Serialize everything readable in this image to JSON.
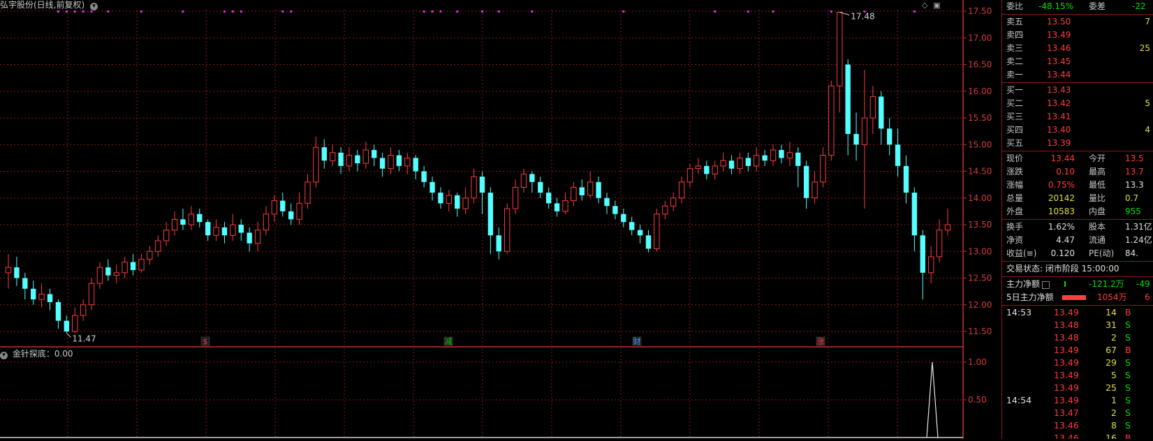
{
  "chart": {
    "title": "弘宇股份(日线,前复权)",
    "indicator_label": "金针探底：0.00",
    "y_ticks": [
      "17.50",
      "17.00",
      "16.50",
      "16.00",
      "15.50",
      "15.00",
      "14.50",
      "14.00",
      "13.50",
      "13.00",
      "12.50",
      "12.00",
      "11.50"
    ],
    "sub_y_ticks": [
      "1.00",
      "0.50"
    ],
    "high_marker": "17.48",
    "low_marker": "11.47",
    "event_marks": [
      {
        "label": "$",
        "color": "#ff3c3c"
      },
      {
        "label": "减",
        "color": "#00d000"
      },
      {
        "label": "财",
        "color": "#4aa0ff"
      },
      {
        "label": "涨",
        "color": "#ff3c3c"
      }
    ],
    "colors": {
      "up": "#ff3c3c",
      "down": "#54ffff",
      "grid": "#8b1a1a",
      "axis": "#c8302a",
      "signal": "#e030e0"
    },
    "chart_data": {
      "type": "candlestick",
      "ylim": [
        11.3,
        17.65
      ],
      "candles": [
        [
          12.6,
          12.7,
          12.95,
          12.3
        ],
        [
          12.7,
          12.5,
          12.9,
          12.35
        ],
        [
          12.5,
          12.3,
          12.6,
          12.1
        ],
        [
          12.3,
          12.1,
          12.45,
          12.0
        ],
        [
          12.1,
          12.2,
          12.4,
          11.95
        ],
        [
          12.2,
          12.05,
          12.3,
          11.9
        ],
        [
          12.05,
          11.7,
          12.1,
          11.55
        ],
        [
          11.7,
          11.5,
          11.8,
          11.47
        ],
        [
          11.5,
          11.8,
          11.95,
          11.47
        ],
        [
          11.8,
          12.0,
          12.1,
          11.7
        ],
        [
          12.0,
          12.4,
          12.5,
          11.9
        ],
        [
          12.4,
          12.7,
          12.8,
          12.3
        ],
        [
          12.7,
          12.55,
          12.85,
          12.45
        ],
        [
          12.55,
          12.6,
          12.75,
          12.4
        ],
        [
          12.6,
          12.8,
          12.9,
          12.5
        ],
        [
          12.8,
          12.65,
          12.95,
          12.55
        ],
        [
          12.65,
          12.85,
          12.95,
          12.6
        ],
        [
          12.85,
          13.0,
          13.1,
          12.75
        ],
        [
          13.0,
          13.2,
          13.3,
          12.9
        ],
        [
          13.2,
          13.4,
          13.55,
          13.1
        ],
        [
          13.4,
          13.6,
          13.75,
          13.3
        ],
        [
          13.6,
          13.5,
          13.8,
          13.4
        ],
        [
          13.5,
          13.7,
          13.85,
          13.4
        ],
        [
          13.7,
          13.55,
          13.8,
          13.45
        ],
        [
          13.55,
          13.3,
          13.6,
          13.2
        ],
        [
          13.3,
          13.45,
          13.6,
          13.2
        ],
        [
          13.45,
          13.3,
          13.55,
          13.15
        ],
        [
          13.3,
          13.5,
          13.7,
          13.2
        ],
        [
          13.5,
          13.35,
          13.6,
          13.2
        ],
        [
          13.35,
          13.15,
          13.45,
          13.0
        ],
        [
          13.15,
          13.4,
          13.55,
          13.0
        ],
        [
          13.4,
          13.7,
          13.85,
          13.3
        ],
        [
          13.7,
          13.95,
          14.05,
          13.55
        ],
        [
          13.95,
          13.75,
          14.1,
          13.65
        ],
        [
          13.75,
          13.6,
          13.9,
          13.5
        ],
        [
          13.6,
          13.9,
          14.1,
          13.5
        ],
        [
          13.9,
          14.3,
          14.45,
          13.8
        ],
        [
          14.3,
          14.95,
          15.15,
          14.2
        ],
        [
          14.95,
          14.7,
          15.1,
          14.55
        ],
        [
          14.7,
          14.85,
          15.0,
          14.6
        ],
        [
          14.85,
          14.6,
          14.95,
          14.45
        ],
        [
          14.6,
          14.8,
          14.95,
          14.5
        ],
        [
          14.8,
          14.65,
          14.9,
          14.5
        ],
        [
          14.65,
          14.9,
          15.05,
          14.55
        ],
        [
          14.9,
          14.75,
          15.0,
          14.6
        ],
        [
          14.75,
          14.55,
          14.85,
          14.4
        ],
        [
          14.55,
          14.8,
          14.95,
          14.45
        ],
        [
          14.8,
          14.6,
          14.9,
          14.5
        ],
        [
          14.6,
          14.75,
          14.85,
          14.45
        ],
        [
          14.75,
          14.5,
          14.8,
          14.35
        ],
        [
          14.5,
          14.3,
          14.6,
          14.2
        ],
        [
          14.3,
          14.1,
          14.4,
          13.95
        ],
        [
          14.1,
          13.9,
          14.2,
          13.8
        ],
        [
          13.9,
          14.05,
          14.15,
          13.75
        ],
        [
          14.05,
          13.8,
          14.1,
          13.65
        ],
        [
          13.8,
          14.0,
          14.2,
          13.7
        ],
        [
          14.0,
          14.4,
          14.55,
          13.9
        ],
        [
          14.4,
          14.1,
          14.5,
          13.7
        ],
        [
          14.1,
          13.3,
          14.2,
          12.95
        ],
        [
          13.3,
          13.0,
          13.45,
          12.85
        ],
        [
          13.0,
          13.8,
          13.9,
          12.95
        ],
        [
          13.8,
          14.2,
          14.35,
          13.7
        ],
        [
          14.2,
          14.45,
          14.55,
          14.1
        ],
        [
          14.45,
          14.3,
          14.5,
          14.1
        ],
        [
          14.3,
          14.1,
          14.4,
          14.0
        ],
        [
          14.1,
          13.9,
          14.2,
          13.8
        ],
        [
          13.9,
          13.75,
          14.0,
          13.65
        ],
        [
          13.75,
          13.95,
          14.1,
          13.7
        ],
        [
          13.95,
          14.2,
          14.3,
          13.85
        ],
        [
          14.2,
          14.05,
          14.35,
          13.95
        ],
        [
          14.05,
          14.3,
          14.5,
          14.0
        ],
        [
          14.3,
          14.0,
          14.4,
          13.9
        ],
        [
          14.0,
          13.85,
          14.1,
          13.7
        ],
        [
          13.85,
          13.7,
          13.95,
          13.6
        ],
        [
          13.7,
          13.55,
          13.8,
          13.45
        ],
        [
          13.55,
          13.4,
          13.65,
          13.3
        ],
        [
          13.4,
          13.3,
          13.5,
          13.15
        ],
        [
          13.3,
          13.05,
          13.4,
          12.98
        ],
        [
          13.05,
          13.7,
          13.8,
          13.0
        ],
        [
          13.7,
          13.85,
          13.95,
          13.6
        ],
        [
          13.85,
          14.0,
          14.1,
          13.75
        ],
        [
          14.0,
          14.3,
          14.4,
          13.9
        ],
        [
          14.3,
          14.55,
          14.65,
          14.2
        ],
        [
          14.55,
          14.6,
          14.75,
          14.45
        ],
        [
          14.6,
          14.45,
          14.7,
          14.35
        ],
        [
          14.45,
          14.6,
          14.7,
          14.35
        ],
        [
          14.6,
          14.7,
          14.85,
          14.5
        ],
        [
          14.7,
          14.55,
          14.8,
          14.45
        ],
        [
          14.55,
          14.75,
          14.85,
          14.45
        ],
        [
          14.75,
          14.6,
          14.85,
          14.5
        ],
        [
          14.6,
          14.8,
          14.95,
          14.5
        ],
        [
          14.8,
          14.7,
          14.9,
          14.6
        ],
        [
          14.7,
          14.9,
          15.0,
          14.6
        ],
        [
          14.9,
          14.75,
          15.0,
          14.65
        ],
        [
          14.75,
          14.85,
          15.05,
          14.6
        ],
        [
          14.85,
          14.6,
          14.95,
          14.2
        ],
        [
          14.6,
          14.0,
          14.7,
          13.8
        ],
        [
          14.0,
          14.3,
          14.5,
          13.9
        ],
        [
          14.3,
          14.8,
          14.95,
          14.2
        ],
        [
          14.8,
          16.1,
          16.2,
          14.7
        ],
        [
          16.1,
          17.48,
          17.48,
          15.6
        ],
        [
          16.5,
          15.2,
          16.6,
          14.8
        ],
        [
          15.2,
          15.0,
          15.6,
          14.7
        ],
        [
          15.0,
          15.5,
          16.4,
          13.8
        ],
        [
          15.5,
          15.9,
          16.1,
          15.2
        ],
        [
          15.9,
          15.3,
          16.0,
          15.0
        ],
        [
          15.3,
          15.0,
          15.5,
          14.8
        ],
        [
          15.0,
          14.6,
          15.3,
          14.4
        ],
        [
          14.6,
          14.1,
          14.8,
          13.9
        ],
        [
          14.1,
          13.3,
          14.2,
          13.0
        ],
        [
          13.3,
          12.6,
          13.4,
          12.1
        ],
        [
          12.6,
          12.9,
          13.1,
          12.4
        ],
        [
          12.9,
          13.4,
          13.6,
          12.8
        ],
        [
          13.4,
          13.5,
          13.8,
          13.3
        ]
      ]
    }
  },
  "panel": {
    "committee": {
      "label1": "委比",
      "value1": "-48.15%",
      "label2": "委差",
      "value2": "-22"
    },
    "asks": [
      {
        "label": "卖五",
        "price": "13.50",
        "vol": "7"
      },
      {
        "label": "卖四",
        "price": "13.49",
        "vol": ""
      },
      {
        "label": "卖三",
        "price": "13.46",
        "vol": "25"
      },
      {
        "label": "卖二",
        "price": "13.45",
        "vol": ""
      },
      {
        "label": "卖一",
        "price": "13.44",
        "vol": ""
      }
    ],
    "bids": [
      {
        "label": "买一",
        "price": "13.43",
        "vol": ""
      },
      {
        "label": "买二",
        "price": "13.42",
        "vol": "5"
      },
      {
        "label": "买三",
        "price": "13.41",
        "vol": ""
      },
      {
        "label": "买四",
        "price": "13.40",
        "vol": "4"
      },
      {
        "label": "买五",
        "price": "13.39",
        "vol": ""
      }
    ],
    "quote": [
      {
        "l1": "现价",
        "v1": "13.44",
        "l2": "今开",
        "v2": "13.5"
      },
      {
        "l1": "涨跌",
        "v1": "0.10",
        "l2": "最高",
        "v2": "13.7"
      },
      {
        "l1": "涨幅",
        "v1": "0.75%",
        "l2": "最低",
        "v2": "13.3"
      },
      {
        "l1": "总量",
        "v1": "20142",
        "l2": "量比",
        "v2": "0.7"
      },
      {
        "l1": "外盘",
        "v1": "10583",
        "l2": "内盘",
        "v2": "955"
      }
    ],
    "stats": [
      {
        "l1": "换手",
        "v1": "1.62%",
        "l2": "股本",
        "v2": "1.31亿"
      },
      {
        "l1": "净资",
        "v1": "4.47",
        "l2": "流通",
        "v2": "1.24亿"
      },
      {
        "l1": "收益(≡)",
        "v1": "0.120",
        "l2": "PE(动)",
        "v2": "84."
      }
    ],
    "trade_status": "交易状态: 闭市阶段 15:00:00",
    "main_flow": {
      "label": "主力净额",
      "value": "-121.2万",
      "pct": "-49"
    },
    "main_flow_5d": {
      "label": "5日主力净额",
      "value": "1054万",
      "pct": "6"
    },
    "ticks": [
      {
        "time": "14:53",
        "price": "13.49",
        "vol": "14",
        "side": "B"
      },
      {
        "time": "",
        "price": "13.48",
        "vol": "31",
        "side": "S"
      },
      {
        "time": "",
        "price": "13.48",
        "vol": "2",
        "side": "S"
      },
      {
        "time": "",
        "price": "13.49",
        "vol": "67",
        "side": "B"
      },
      {
        "time": "",
        "price": "13.49",
        "vol": "29",
        "side": "S"
      },
      {
        "time": "",
        "price": "13.49",
        "vol": "5",
        "side": "S"
      },
      {
        "time": "",
        "price": "13.49",
        "vol": "25",
        "side": "S"
      },
      {
        "time": "14:54",
        "price": "13.49",
        "vol": "1",
        "side": "S"
      },
      {
        "time": "",
        "price": "13.47",
        "vol": "2",
        "side": "S"
      },
      {
        "time": "",
        "price": "13.46",
        "vol": "8",
        "side": "S"
      },
      {
        "time": "",
        "price": "13.46",
        "vol": "16",
        "side": "B"
      }
    ]
  }
}
